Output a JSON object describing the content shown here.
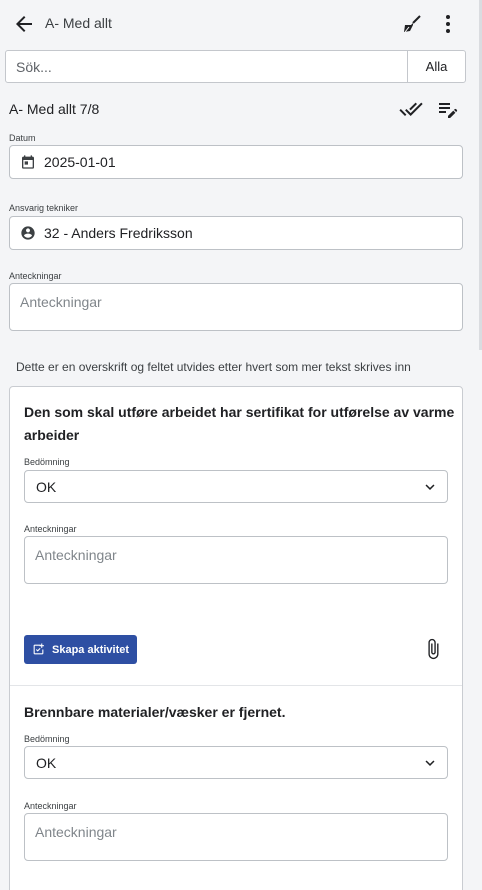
{
  "header": {
    "title": "A- Med allt",
    "back_icon": "arrow-left-icon",
    "action_icon": "broom-icon",
    "menu_icon": "more-vert-icon"
  },
  "search": {
    "placeholder": "Sök...",
    "value": "",
    "filter_label": "Alla"
  },
  "section": {
    "title": "A- Med allt 7/8",
    "check_all_icon": "double-check-icon",
    "edit_icon": "edit-note-icon"
  },
  "fields": {
    "date_label": "Datum",
    "date_value": "2025-01-01",
    "tech_label": "Ansvarig tekniker",
    "tech_value": "32 - Anders Fredriksson",
    "notes_label": "Anteckningar",
    "notes_placeholder": "Anteckningar"
  },
  "info_text": "Dette er en overskrift og feltet utvides etter hvert som mer tekst skrives inn",
  "questions": [
    {
      "title_line1": "Den som skal utføre arbeidet har sertifikat for utførelse av varme",
      "title_line2": "arbeider",
      "rating_label": "Bedömning",
      "rating_value": "OK",
      "notes_label": "Anteckningar",
      "notes_placeholder": "Anteckningar",
      "action_label": "Skapa aktivitet",
      "attach_icon": "paperclip-icon"
    },
    {
      "title_line1": "Brennbare materialer/væsker er fjernet.",
      "rating_label": "Bedömning",
      "rating_value": "OK",
      "notes_label": "Anteckningar",
      "notes_placeholder": "Anteckningar"
    }
  ],
  "colors": {
    "primary": "#2e4fa3",
    "background": "#f4f5f7",
    "border": "#bdc1c6"
  }
}
